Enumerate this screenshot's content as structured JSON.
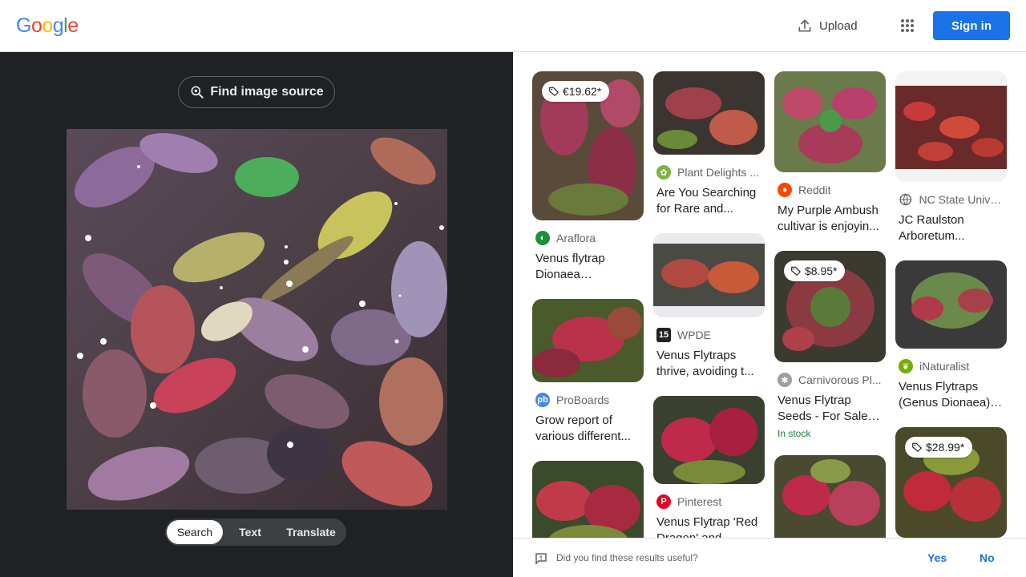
{
  "header": {
    "logo_letters": [
      "G",
      "o",
      "o",
      "g",
      "l",
      "e"
    ],
    "logo_colors": [
      "#4285F4",
      "#EA4335",
      "#FBBC05",
      "#4285F4",
      "#34A853",
      "#EA4335"
    ],
    "upload_label": "Upload",
    "signin_label": "Sign in"
  },
  "left": {
    "find_source_label": "Find image source",
    "modes": [
      "Search",
      "Text",
      "Translate"
    ],
    "active_mode": "Search"
  },
  "results": {
    "columns": [
      [
        {
          "price": "€19.62*",
          "source": "Araflora",
          "source_icon": "araflora-icon",
          "icon_color": "#1e8e3e",
          "title": "Venus flytrap Dionaea muscipul..."
        },
        {
          "price": "",
          "source": "ProBoards",
          "source_icon": "proboards-icon",
          "icon_color": "#4285f4",
          "title": "Grow report of various different..."
        },
        {
          "price": "",
          "source": "",
          "title": ""
        }
      ],
      [
        {
          "price": "",
          "source": "Plant Delights ...",
          "source_icon": "plant-delights-icon",
          "icon_color": "#7cb342",
          "title": "Are You Searching for Rare and..."
        },
        {
          "price": "",
          "source": "WPDE",
          "source_icon": "wpde-icon",
          "icon_color": "#202124",
          "title": "Venus Flytraps thrive, avoiding t..."
        },
        {
          "price": "",
          "source": "Pinterest",
          "source_icon": "pinterest-icon",
          "icon_color": "#e60023",
          "title": "Venus Flytrap 'Red Dragon' and..."
        }
      ],
      [
        {
          "price": "",
          "source": "Reddit",
          "source_icon": "reddit-icon",
          "icon_color": "#ff4500",
          "title": "My Purple Ambush cultivar is enjoyin..."
        },
        {
          "price": "$8.95*",
          "source": "Carnivorous Pl...",
          "source_icon": "carnivorous-plants-icon",
          "icon_color": "#9e9e9e",
          "title": "Venus Flytrap Seeds - For Sale |...",
          "stock": "In stock"
        },
        {
          "price": "",
          "source": "",
          "title": ""
        }
      ],
      [
        {
          "price": "",
          "source": "NC State Unive...",
          "source_icon": "globe-icon",
          "icon_color": "#5f6368",
          "title": "JC Raulston Arboretum..."
        },
        {
          "price": "",
          "source": "iNaturalist",
          "source_icon": "inaturalist-icon",
          "icon_color": "#74ac00",
          "title": "Venus Flytraps (Genus Dionaea) ·..."
        },
        {
          "price": "$28.99*",
          "source": "",
          "title": ""
        }
      ]
    ]
  },
  "feedback": {
    "question": "Did you find these results useful?",
    "yes_label": "Yes",
    "no_label": "No"
  }
}
